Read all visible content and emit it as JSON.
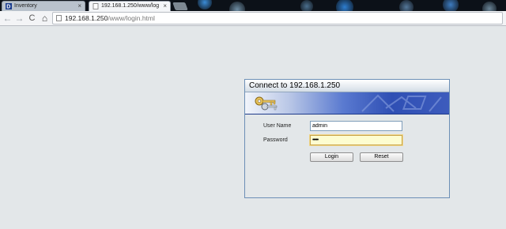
{
  "browser": {
    "tabs": [
      {
        "label": "Inventory",
        "close": "×",
        "active": false
      },
      {
        "label": "192.168.1.250/www/login",
        "close": "×",
        "active": true
      }
    ],
    "address": {
      "host": "192.168.1.250",
      "path": "/www/login.html"
    },
    "nav": {
      "back": "←",
      "forward": "→",
      "reload": "C",
      "home": "⌂"
    }
  },
  "dialog": {
    "title": "Connect to 192.168.1.250",
    "username_label": "User Name",
    "username_value": "admin",
    "password_label": "Password",
    "password_value": "•••••",
    "login_label": "Login",
    "reset_label": "Reset"
  },
  "colors": {
    "dialog_border": "#6c8fb6",
    "banner_blue": "#2f4fb4",
    "password_bg": "#fdfdd0"
  }
}
